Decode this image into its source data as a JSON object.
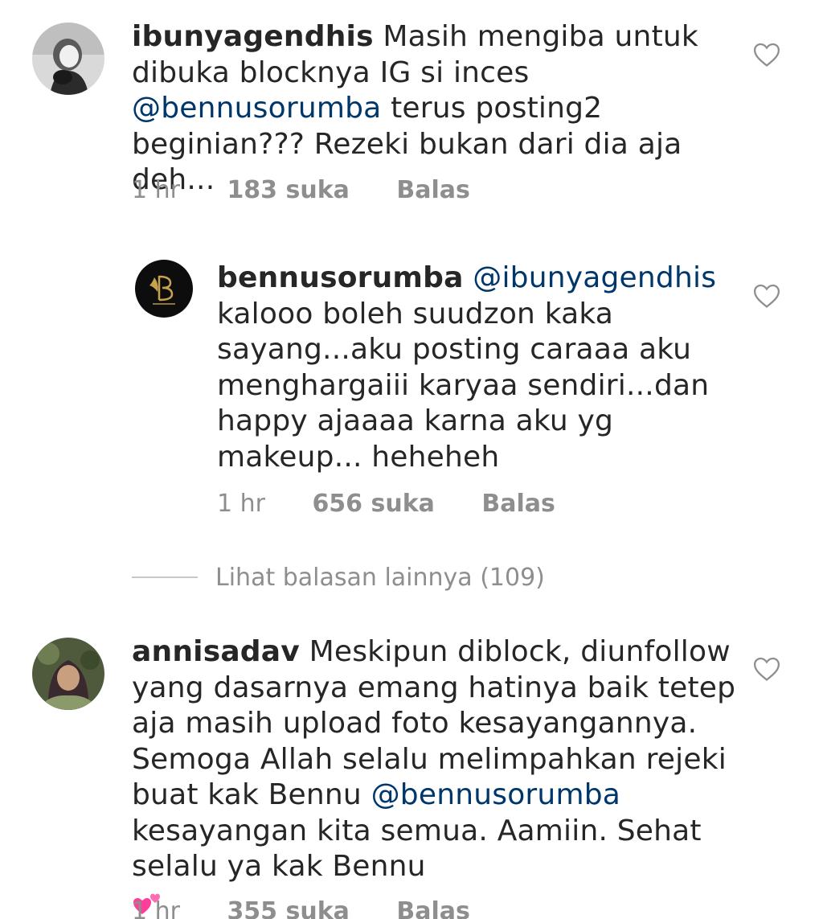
{
  "comments": [
    {
      "username": "ibunyagendhis",
      "text_before": " Masih mengiba untuk dibuka blocknya IG si inces ",
      "mention": "@bennusorumba",
      "text_after": " terus posting2 beginian??? Rezeki bukan dari dia aja deh...",
      "time": "1 hr",
      "likes": "183 suka",
      "reply_label": "Balas",
      "avatar_icon": "profile-photo"
    },
    {
      "username": "bennusorumba",
      "mention": "@ibunyagendhis",
      "text_after": " kalooo boleh suudzon kaka sayang...aku posting caraaa aku menghargaiii karyaa sendiri...dan happy ajaaaa karna aku yg makeup... heheheh",
      "time": "1 hr",
      "likes": "656 suka",
      "reply_label": "Balas",
      "avatar_icon": "bennu-logo"
    },
    {
      "username": "annisadav",
      "text_before": " Meskipun diblock, diunfollow yang dasarnya emang hatinya baik tetep aja masih upload foto kesayangannya. Semoga Allah selalu melimpahkan rejeki buat kak Bennu ",
      "mention": "@bennusorumba",
      "text_after": " kesayangan kita semua. Aamiin. Sehat selalu ya kak Bennu",
      "emoji": "two-hearts",
      "time": "1 hr",
      "likes": "355 suka",
      "reply_label": "Balas",
      "avatar_icon": "profile-photo"
    }
  ],
  "view_replies": "Lihat balasan lainnya (109)",
  "colors": {
    "text": "#262626",
    "mention": "#00376b",
    "meta": "#8e8e8e",
    "divider": "#c7c7c7"
  }
}
